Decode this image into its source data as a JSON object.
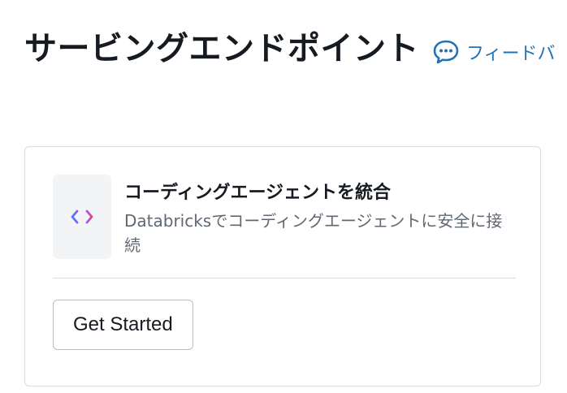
{
  "page": {
    "title": "サービングエンドポイント",
    "feedback_label": "フィードバ",
    "accent_color": "#2272b4"
  },
  "card": {
    "icon": "code-brackets-icon",
    "title": "コーディングエージェントを統合",
    "description": "Databricksでコーディングエージェントに安全に接続",
    "button_label": "Get Started"
  }
}
